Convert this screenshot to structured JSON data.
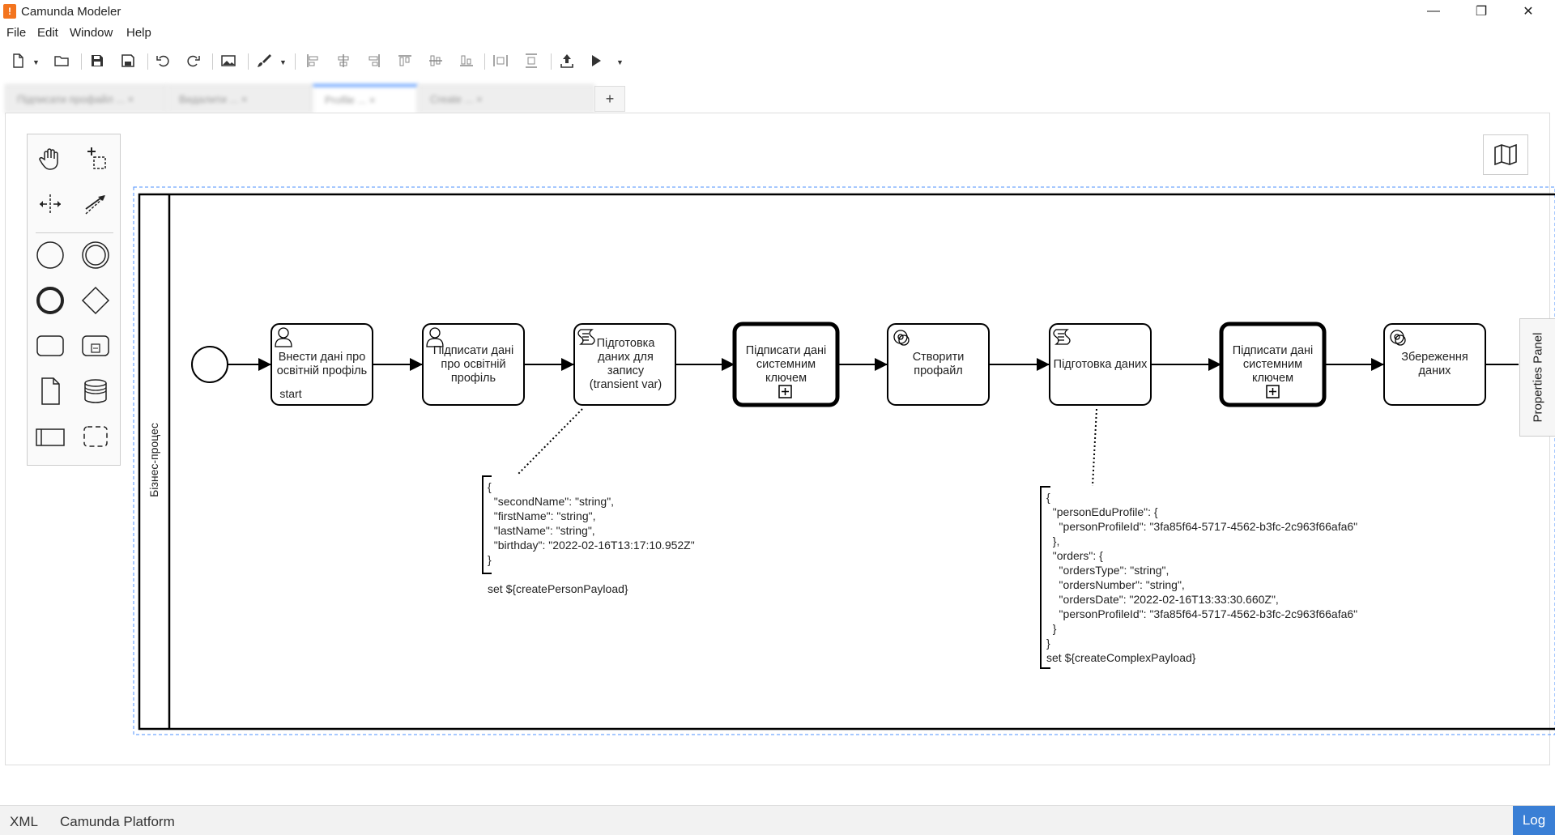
{
  "window": {
    "title": "Camunda Modeler",
    "app_icon": "camunda-logo-icon"
  },
  "menu": [
    "File",
    "Edit",
    "Window",
    "Help"
  ],
  "toolbar_icons": [
    "new-file-icon",
    "open-file-icon",
    "save-icon",
    "save-as-icon",
    "undo-icon",
    "redo-icon",
    "export-image-icon",
    "color-brush-icon",
    "align-left-icon",
    "align-center-icon",
    "align-right-icon",
    "align-top-icon",
    "align-middle-icon",
    "align-bottom-icon",
    "distribute-horizontal-icon",
    "distribute-vertical-icon",
    "deploy-icon",
    "run-icon"
  ],
  "tabs": [
    "Підписати профайл ... ×",
    "Видалити ... ×",
    "Profile ... ×",
    "Create ... ×"
  ],
  "tab_plus": "+",
  "pool_label": "Бізнес-процес",
  "start_event_label": "start",
  "tasks": [
    {
      "type": "user",
      "label": "Внести дані про освітній профіль"
    },
    {
      "type": "user",
      "label": "Підписати дані про освітній профіль"
    },
    {
      "type": "script",
      "label": "Підготовка даних для запису (transient var)"
    },
    {
      "type": "call",
      "label": "Підписати дані системним ключем"
    },
    {
      "type": "service",
      "label": "Створити профайл"
    },
    {
      "type": "script",
      "label": "Підготовка даних"
    },
    {
      "type": "call",
      "label": "Підписати дані системним ключем"
    },
    {
      "type": "service",
      "label": "Збереження даних"
    }
  ],
  "annotation1": "{\n  \"secondName\": \"string\",\n  \"firstName\": \"string\",\n  \"lastName\": \"string\",\n  \"birthday\": \"2022-02-16T13:17:10.952Z\"\n}\n\nset ${createPersonPayload}",
  "annotation2": "{\n  \"personEduProfile\": {\n    \"personProfileId\": \"3fa85f64-5717-4562-b3fc-2c963f66afa6\"\n  },\n  \"orders\": {\n    \"ordersType\": \"string\",\n    \"ordersNumber\": \"string\",\n    \"ordersDate\": \"2022-02-16T13:33:30.660Z\",\n    \"personProfileId\": \"3fa85f64-5717-4562-b3fc-2c963f66afa6\"\n  }\n}\nset ${createComplexPayload}",
  "properties_panel": "Properties Panel",
  "footer": {
    "xml": "XML",
    "platform": "Camunda Platform",
    "log": "Log"
  },
  "colors": {
    "accent": "#3a7fd5",
    "app_icon": "#f3741e",
    "selection": "#4d90fe"
  }
}
